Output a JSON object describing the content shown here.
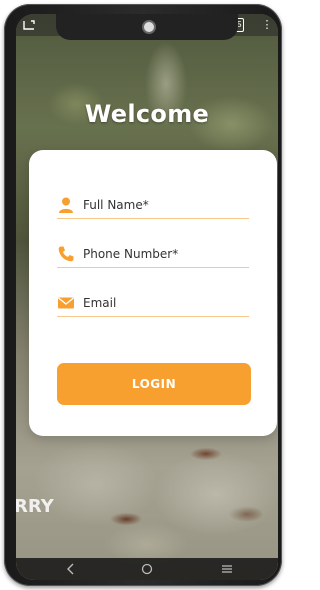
{
  "header": {
    "title": "Welcome"
  },
  "form": {
    "name_placeholder": "Full Name*",
    "phone_placeholder": "Phone Number*",
    "email_placeholder": "Email",
    "login_label": "LOGIN"
  },
  "background": {
    "brand_partial_text": "RRY"
  },
  "status_bar": {
    "right_badge": "15"
  },
  "colors": {
    "accent": "#f7a030",
    "underline": "#f6c98a",
    "card": "#ffffff"
  }
}
